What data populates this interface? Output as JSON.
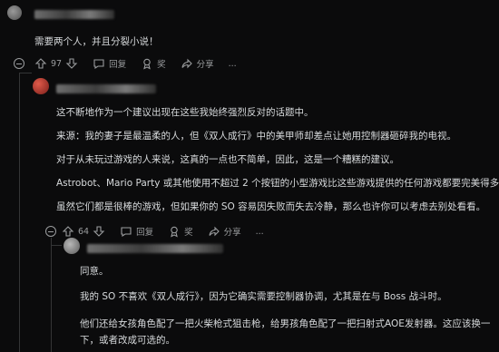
{
  "comments": [
    {
      "body": [
        "需要两个人，并且分裂小说！"
      ],
      "actions": {
        "upvotes": "97",
        "reply": "回复",
        "award": "奖",
        "share": "分享",
        "more": "..."
      }
    },
    {
      "body": [
        "这不断地作为一个建议出现在这些我始终强烈反对的话题中。",
        "来源：我的妻子是最温柔的人，但《双人成行》中的美甲师却差点让她用控制器砸碎我的电视。",
        "对于从未玩过游戏的人来说，这真的一点也不简单，因此，这是一个糟糕的建议。",
        "Astrobot、Mario Party 或其他使用不超过 2 个按钮的小型游戏比这些游戏提供的任何游戏都要完美得多。",
        "虽然它们都是很棒的游戏，但如果你的 SO 容易因失败而失去冷静，那么也许你可以考虑去别处看看。"
      ],
      "actions": {
        "upvotes": "64",
        "reply": "回复",
        "award": "奖",
        "share": "分享",
        "more": "..."
      }
    },
    {
      "body": [
        "同意。",
        "我的 SO 不喜欢《双人成行》，因为它确实需要控制器协调，尤其是在与 Boss 战斗时。",
        "他们还给女孩角色配了一把火柴枪式狙击枪，给男孩角色配了一把扫射式AOE发射器。这应该换一",
        "下，或者改成可选的。"
      ]
    }
  ]
}
